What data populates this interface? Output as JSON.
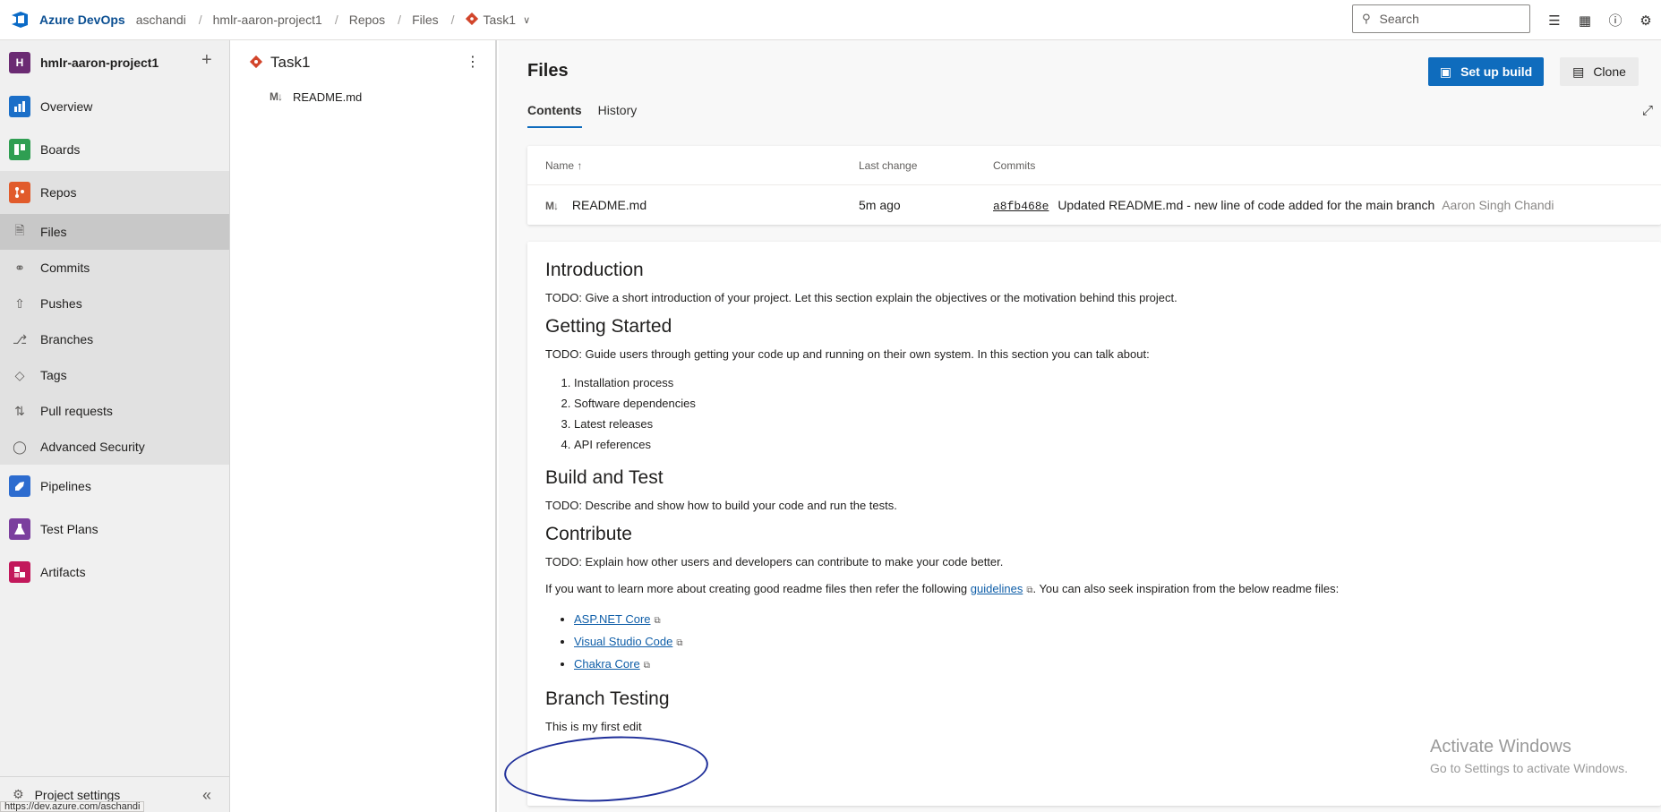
{
  "topbar": {
    "brand": "Azure DevOps",
    "breadcrumbs": [
      "aschandi",
      "hmlr-aaron-project1",
      "Repos",
      "Files",
      "Task1"
    ],
    "search_placeholder": "Search",
    "icons": [
      "task-list-icon",
      "shopping-bag-icon",
      "help-icon",
      "user-settings-icon"
    ]
  },
  "leftnav": {
    "project_initial": "H",
    "project_name": "hmlr-aaron-project1",
    "items": [
      {
        "label": "Overview",
        "icon": "overview-icon",
        "color": "#1b6fc8"
      },
      {
        "label": "Boards",
        "icon": "boards-icon",
        "color": "#2f9e52"
      },
      {
        "label": "Repos",
        "icon": "repos-icon",
        "color": "#e15b2b"
      },
      {
        "label": "Pipelines",
        "icon": "pipelines-icon",
        "color": "#2d6ccf"
      },
      {
        "label": "Test Plans",
        "icon": "test-plans-icon",
        "color": "#7b3f9e"
      },
      {
        "label": "Artifacts",
        "icon": "artifacts-icon",
        "color": "#c2185b"
      }
    ],
    "repo_sub": [
      {
        "label": "Files",
        "icon": "files-icon"
      },
      {
        "label": "Commits",
        "icon": "commits-icon"
      },
      {
        "label": "Pushes",
        "icon": "pushes-icon"
      },
      {
        "label": "Branches",
        "icon": "branches-icon"
      },
      {
        "label": "Tags",
        "icon": "tags-icon"
      },
      {
        "label": "Pull requests",
        "icon": "pull-requests-icon"
      },
      {
        "label": "Advanced Security",
        "icon": "shield-icon"
      }
    ],
    "settings_label": "Project settings",
    "status_url": "https://dev.azure.com/aschandi"
  },
  "filetree": {
    "repo_name": "Task1",
    "files": [
      "README.md"
    ]
  },
  "main": {
    "title": "Files",
    "setup_build": "Set up build",
    "clone": "Clone",
    "tabs": [
      "Contents",
      "History"
    ],
    "columns": {
      "name": "Name",
      "last_change": "Last change",
      "commits": "Commits"
    },
    "rows": [
      {
        "name": "README.md",
        "last_change": "5m ago",
        "commit_hash": "a8fb468e",
        "commit_message": "Updated README.md - new line of code added for the main branch",
        "author": "Aaron Singh Chandi"
      }
    ]
  },
  "readme": {
    "intro_heading": "Introduction",
    "intro_text": "TODO: Give a short introduction of your project. Let this section explain the objectives or the motivation behind this project.",
    "gs_heading": "Getting Started",
    "gs_text": "TODO: Guide users through getting your code up and running on their own system. In this section you can talk about:",
    "gs_list": [
      "Installation process",
      "Software dependencies",
      "Latest releases",
      "API references"
    ],
    "bt_heading": "Build and Test",
    "bt_text": "TODO: Describe and show how to build your code and run the tests.",
    "contrib_heading": "Contribute",
    "contrib_text": "TODO: Explain how other users and developers can contribute to make your code better.",
    "learn_pre": "If you want to learn more about creating good readme files then refer the following ",
    "learn_link": "guidelines",
    "learn_post": ". You can also seek inspiration from the below readme files:",
    "links": [
      "ASP.NET Core",
      "Visual Studio Code",
      "Chakra Core"
    ],
    "branch_heading": "Branch Testing",
    "branch_text": "This is my first edit"
  },
  "watermark": {
    "title": "Activate Windows",
    "subtitle": "Go to Settings to activate Windows."
  },
  "colors": {
    "accent": "#0f6cbd",
    "annotation_circle": "#1f2f9a"
  }
}
